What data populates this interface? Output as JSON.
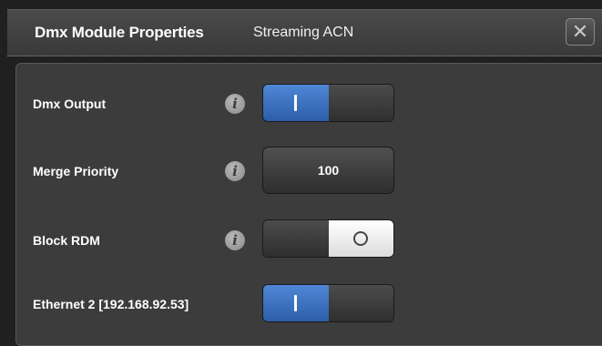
{
  "window": {
    "title": "Dmx Module Properties",
    "subtitle": "Streaming ACN",
    "close_icon": "close-icon"
  },
  "rows": [
    {
      "label": "Dmx Output",
      "info_icon": "info-icon",
      "toggle": {
        "state": "on",
        "on_glyph": "|",
        "off_glyph": ""
      }
    },
    {
      "label": "Merge Priority",
      "info_icon": "info-icon",
      "value": "100"
    },
    {
      "label": "Block RDM",
      "info_icon": "info-icon",
      "toggle": {
        "state": "off",
        "on_glyph": "",
        "off_glyph": "O"
      }
    },
    {
      "label": "Ethernet 2 [192.168.92.53]",
      "toggle": {
        "state": "on",
        "on_glyph": "|",
        "off_glyph": ""
      }
    }
  ],
  "colors": {
    "toggle_on": "#3d74c4",
    "panel_bg": "#3c3c3c",
    "window_bg": "#202020"
  }
}
